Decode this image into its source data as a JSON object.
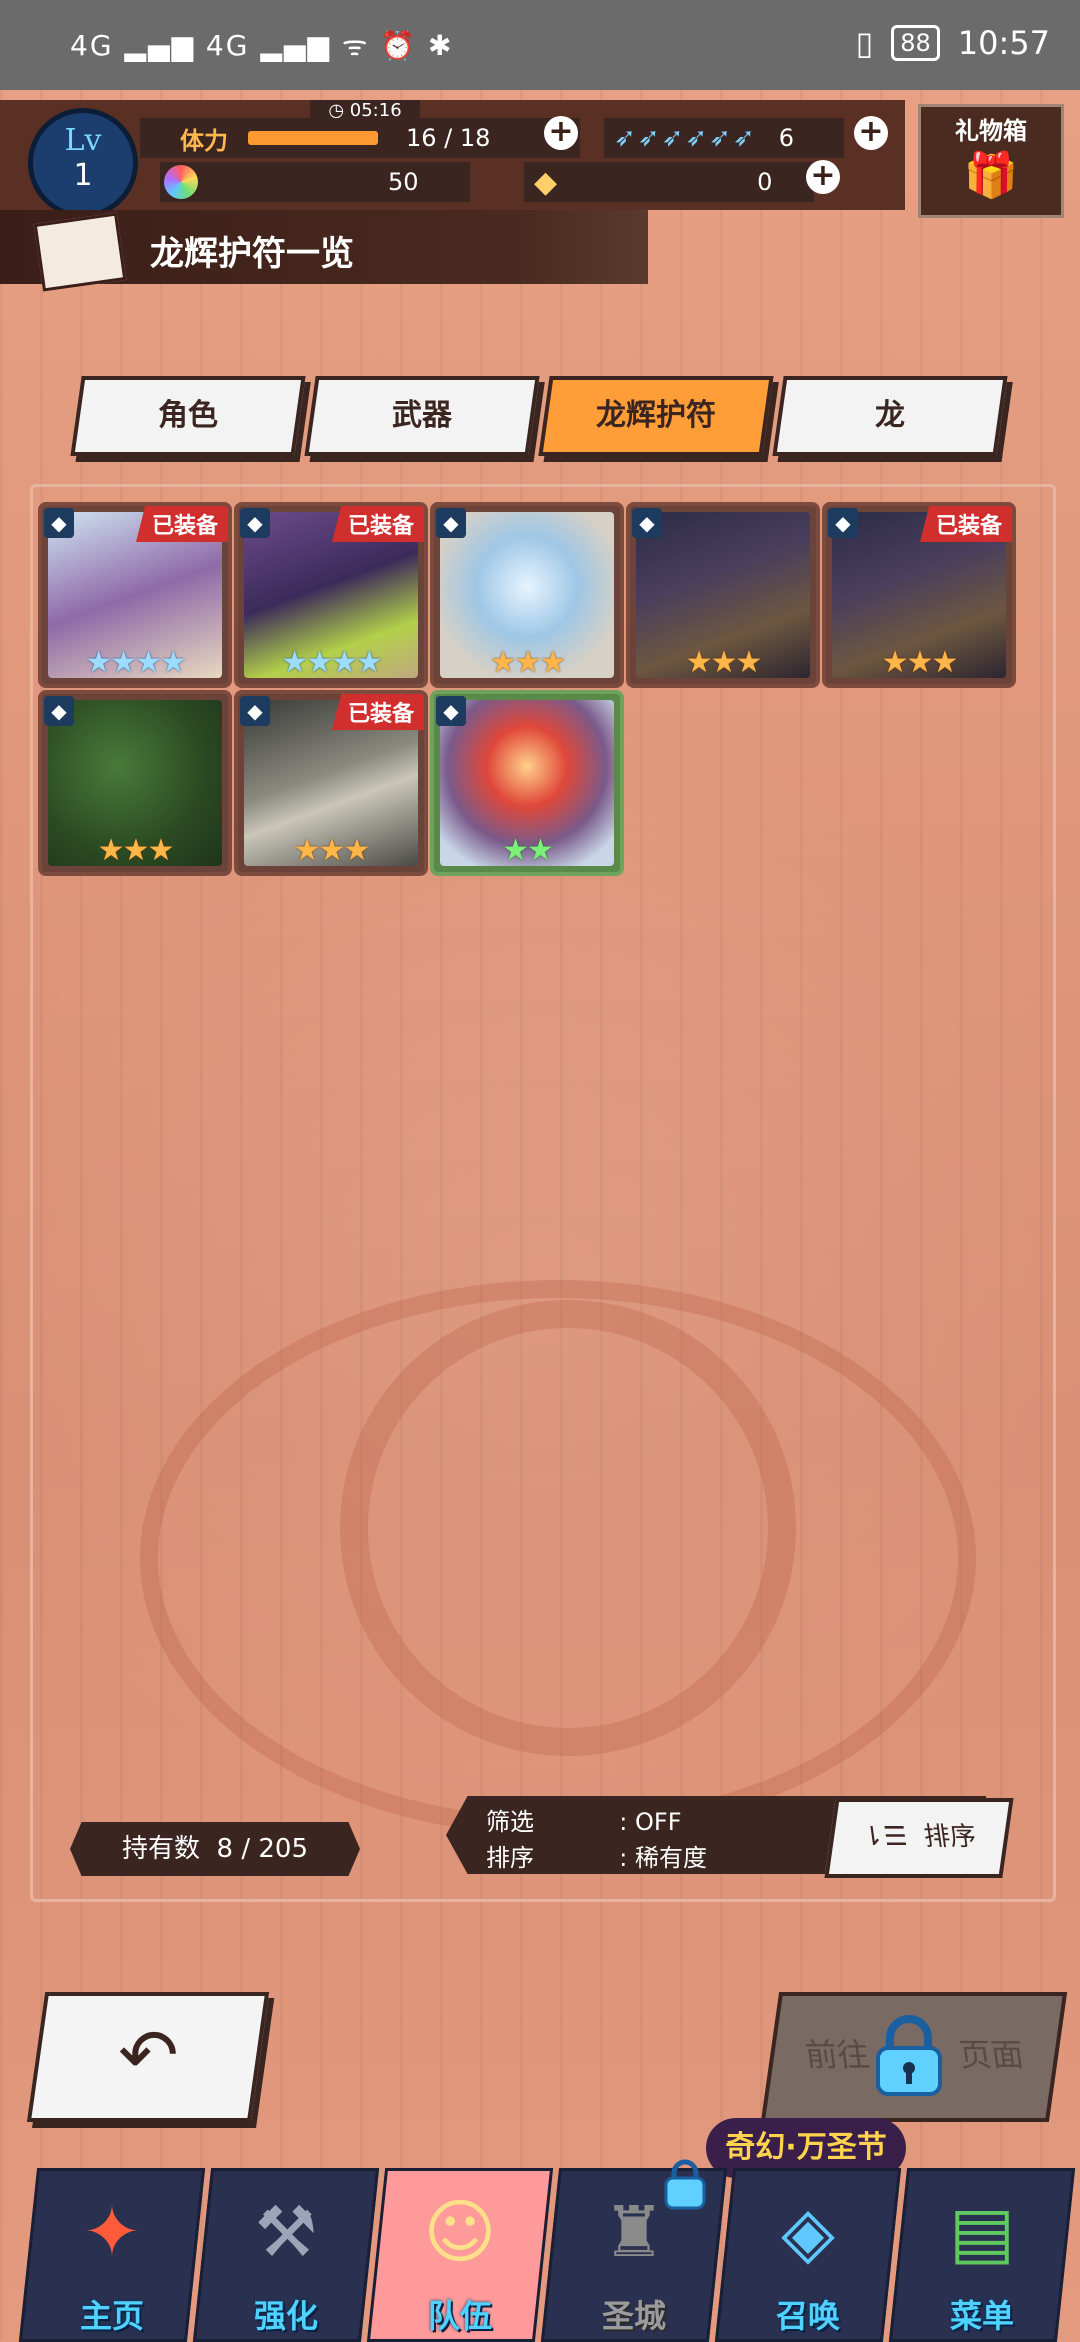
{
  "status_bar": {
    "left_text": "⁴⁶ᵢₗₗ ⁴⁶ᵢₗₗ",
    "time": "10:57",
    "battery": "88"
  },
  "header": {
    "level_label": "Lv",
    "level": "1",
    "stamina_label": "体力",
    "timer": "05:16",
    "stamina": "16 / 18",
    "wings": "6",
    "rainbow_count": "50",
    "gem_count": "0",
    "gift_label": "礼物箱"
  },
  "page_title": "龙辉护符一览",
  "tabs": [
    {
      "label": "角色",
      "active": false
    },
    {
      "label": "武器",
      "active": false
    },
    {
      "label": "龙辉护符",
      "active": true
    },
    {
      "label": "龙",
      "active": false
    }
  ],
  "cards": [
    {
      "equipped": "已装备",
      "stars": "★★★★",
      "star_color": "blue",
      "art": "purple-hair-character"
    },
    {
      "equipped": "已装备",
      "stars": "★★★★",
      "star_color": "blue",
      "art": "purple-character-fruit"
    },
    {
      "equipped": "",
      "stars": "★★★",
      "star_color": "gold",
      "art": "ice-crystal"
    },
    {
      "equipped": "",
      "stars": "★★★",
      "star_color": "gold",
      "art": "storm-eagle"
    },
    {
      "equipped": "已装备",
      "stars": "★★★",
      "star_color": "gold",
      "art": "storm-eagle"
    },
    {
      "equipped": "",
      "stars": "★★★",
      "star_color": "gold",
      "art": "forest"
    },
    {
      "equipped": "已装备",
      "stars": "★★★",
      "star_color": "gold",
      "art": "plague-mask"
    },
    {
      "equipped": "",
      "stars": "★★",
      "star_color": "green",
      "art": "red-flower-orb"
    }
  ],
  "footer": {
    "count_label": "持有数",
    "count_value": "8 / 205",
    "filter_label": "筛选",
    "filter_value": ": OFF",
    "sort_label": "排序",
    "sort_value": ": 稀有度",
    "sort_button": "排序"
  },
  "actions": {
    "back_icon": "back-arrow-icon",
    "goto_label": "前往",
    "goto_suffix": "页面"
  },
  "event_label": "奇幻·万圣节",
  "nav": [
    {
      "label": "主页",
      "icon": "home-star-icon"
    },
    {
      "label": "强化",
      "icon": "hammer-icon"
    },
    {
      "label": "队伍",
      "icon": "team-portrait-icon"
    },
    {
      "label": "圣城",
      "icon": "castle-icon"
    },
    {
      "label": "召唤",
      "icon": "crystal-icon"
    },
    {
      "label": "菜单",
      "icon": "book-icon"
    }
  ]
}
